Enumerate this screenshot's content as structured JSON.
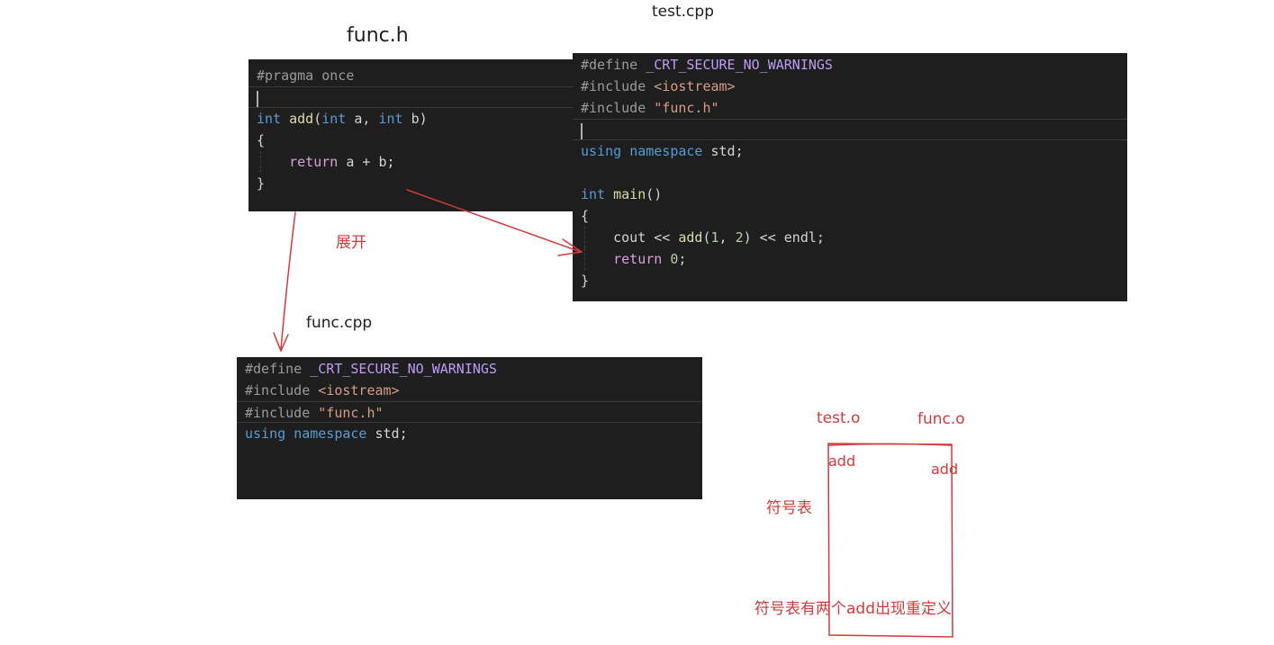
{
  "labels": {
    "func_h": "func.h",
    "test_cpp": "test.cpp",
    "func_cpp": "func.cpp",
    "expand": "展开",
    "test_o": "test.o",
    "func_o": "func.o",
    "add_left": "add",
    "add_right": "add",
    "symbol_table": "符号表",
    "conclusion": "符号表有两个add出现重定义"
  },
  "func_h_code": {
    "l1": {
      "pre": "#pragma once"
    },
    "l3": {
      "kw1": "int",
      "fn": "add",
      "p1": "(",
      "kw2": "int",
      "p2": " a, ",
      "kw3": "int",
      "p3": " b)"
    },
    "l4": {
      "p": "{"
    },
    "l5": {
      "ctl": "return",
      "p": " a + b;"
    },
    "l6": {
      "p": "}"
    }
  },
  "test_cpp_code": {
    "l1": {
      "pre": "#define",
      "macro": "_CRT_SECURE_NO_WARNINGS"
    },
    "l2": {
      "pre": "#include",
      "str": "<iostream>"
    },
    "l3": {
      "pre": "#include",
      "str": "\"func.h\""
    },
    "l5": {
      "kw1": "using",
      "kw2": "namespace",
      "p": " std;"
    },
    "l7": {
      "kw": "int",
      "fn": "main",
      "p": "()"
    },
    "l8": {
      "p": "{"
    },
    "l9": {
      "p1": "cout << ",
      "fn": "add",
      "p2": "(",
      "n1": "1",
      "p3": ", ",
      "n2": "2",
      "p4": ") << endl;"
    },
    "l10": {
      "ctl": "return",
      "n": "0",
      "p": ";"
    },
    "l11": {
      "p": "}"
    }
  },
  "func_cpp_code": {
    "l1": {
      "pre": "#define",
      "macro": "_CRT_SECURE_NO_WARNINGS"
    },
    "l2": {
      "pre": "#include",
      "str": "<iostream>"
    },
    "l3": {
      "pre": "#include",
      "str": "\"func.h\""
    },
    "l4": {
      "kw1": "using",
      "kw2": "namespace",
      "p": " std;"
    }
  },
  "colors": {
    "editor_bg": "#1e1e1e",
    "annotation_red": "#d03a3a",
    "keyword_blue": "#569cd6",
    "function_yellow": "#dcdcaa",
    "control_pink": "#d8a0df",
    "string_orange": "#d69d85",
    "macro_purple": "#bd9cf4"
  }
}
